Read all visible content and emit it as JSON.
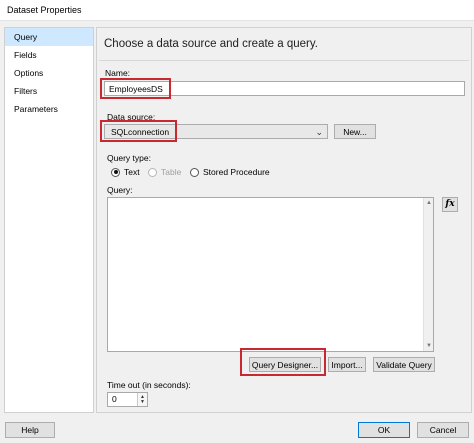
{
  "window": {
    "title": "Dataset Properties"
  },
  "sidebar": {
    "items": [
      {
        "label": "Query",
        "selected": true
      },
      {
        "label": "Fields"
      },
      {
        "label": "Options"
      },
      {
        "label": "Filters"
      },
      {
        "label": "Parameters"
      }
    ]
  },
  "main": {
    "heading": "Choose a data source and create a query.",
    "name_label": "Name:",
    "name_value": "EmployeesDS",
    "datasource_label": "Data source:",
    "datasource_value": "SQLconnection",
    "new_button": "New...",
    "query_type_label": "Query type:",
    "query_types": [
      {
        "label": "Text",
        "checked": true,
        "enabled": true
      },
      {
        "label": "Table",
        "checked": false,
        "enabled": false
      },
      {
        "label": "Stored Procedure",
        "checked": false,
        "enabled": true
      }
    ],
    "query_label": "Query:",
    "query_value": "",
    "fx_label": "fx",
    "query_designer_button": "Query Designer...",
    "import_button": "Import...",
    "validate_button": "Validate Query",
    "timeout_label": "Time out (in seconds):",
    "timeout_value": "0"
  },
  "footer": {
    "help_button": "Help",
    "ok_button": "OK",
    "cancel_button": "Cancel"
  },
  "colors": {
    "highlight": "#c8282f",
    "selection": "#cde8ff",
    "accent": "#0078d7"
  }
}
